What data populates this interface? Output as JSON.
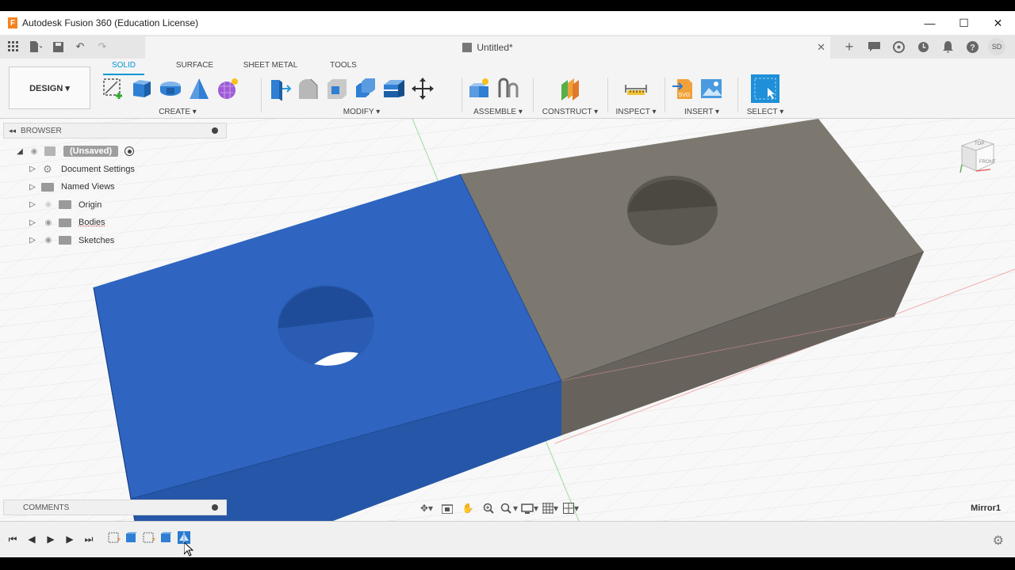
{
  "window": {
    "title": "Autodesk Fusion 360 (Education License)",
    "minimize": "—",
    "maximize": "☐",
    "close": "✕"
  },
  "document": {
    "tab_title": "Untitled*",
    "tab_close": "✕"
  },
  "user": {
    "initials": "SD"
  },
  "ribbon": {
    "workspace": "DESIGN ▾",
    "tabs": [
      "SOLID",
      "SURFACE",
      "SHEET METAL",
      "TOOLS"
    ],
    "active_tab": "SOLID",
    "groups": {
      "create": "CREATE ▾",
      "modify": "MODIFY ▾",
      "assemble": "ASSEMBLE ▾",
      "construct": "CONSTRUCT ▾",
      "inspect": "INSPECT ▾",
      "insert": "INSERT ▾",
      "select": "SELECT ▾"
    }
  },
  "browser": {
    "title": "BROWSER",
    "root": "(Unsaved)",
    "items": [
      "Document Settings",
      "Named Views",
      "Origin",
      "Bodies",
      "Sketches"
    ]
  },
  "comments": {
    "title": "COMMENTS"
  },
  "status": {
    "last_feature": "Mirror1"
  },
  "viewcube": {
    "top": "TOP",
    "front": "FRONT"
  },
  "colors": {
    "blue_body": "#2f65c0",
    "grey_body": "#7a7670",
    "accent": "#0696d7"
  }
}
